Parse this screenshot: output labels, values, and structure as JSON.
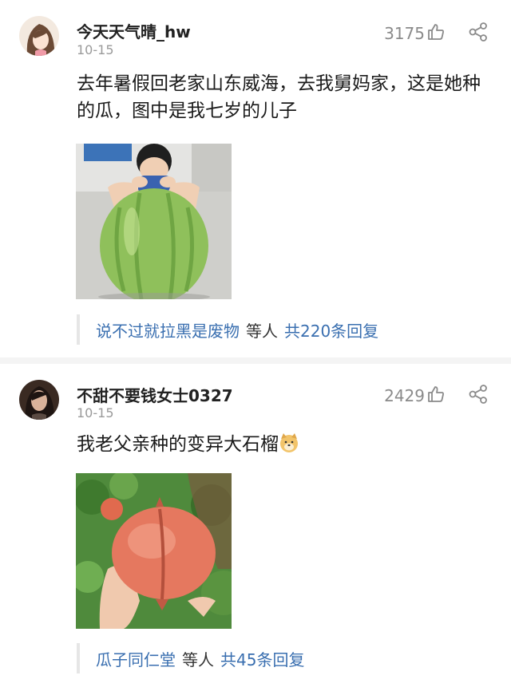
{
  "comments": [
    {
      "username": "今天天气晴_hw",
      "date": "10-15",
      "likes": "3175",
      "text": "去年暑假回老家山东威海，去我舅妈家，这是她种的瓜，图中是我七岁的儿子",
      "replies": {
        "replier": "说不过就拉黑是废物",
        "middle": "等人",
        "count": "共220条回复"
      },
      "icons": [
        "avatar-girl-icon",
        "thumbs-up-icon",
        "share-icon"
      ],
      "photo_subject": "boy-with-giant-melon"
    },
    {
      "username": "不甜不要钱女士0327",
      "date": "10-15",
      "likes": "2429",
      "text": "我老父亲种的变异大石榴",
      "emoji": "doge-emoji-icon",
      "replies": {
        "replier": "瓜子同仁堂",
        "middle": "等人",
        "count": "共45条回复"
      },
      "icons": [
        "avatar-woman-icon",
        "thumbs-up-icon",
        "share-icon"
      ],
      "photo_subject": "hand-holding-giant-pomegranate"
    }
  ],
  "colors": {
    "link": "#3a6fb0",
    "meta": "#9a9a9a",
    "divider": "#f4f4f4"
  }
}
